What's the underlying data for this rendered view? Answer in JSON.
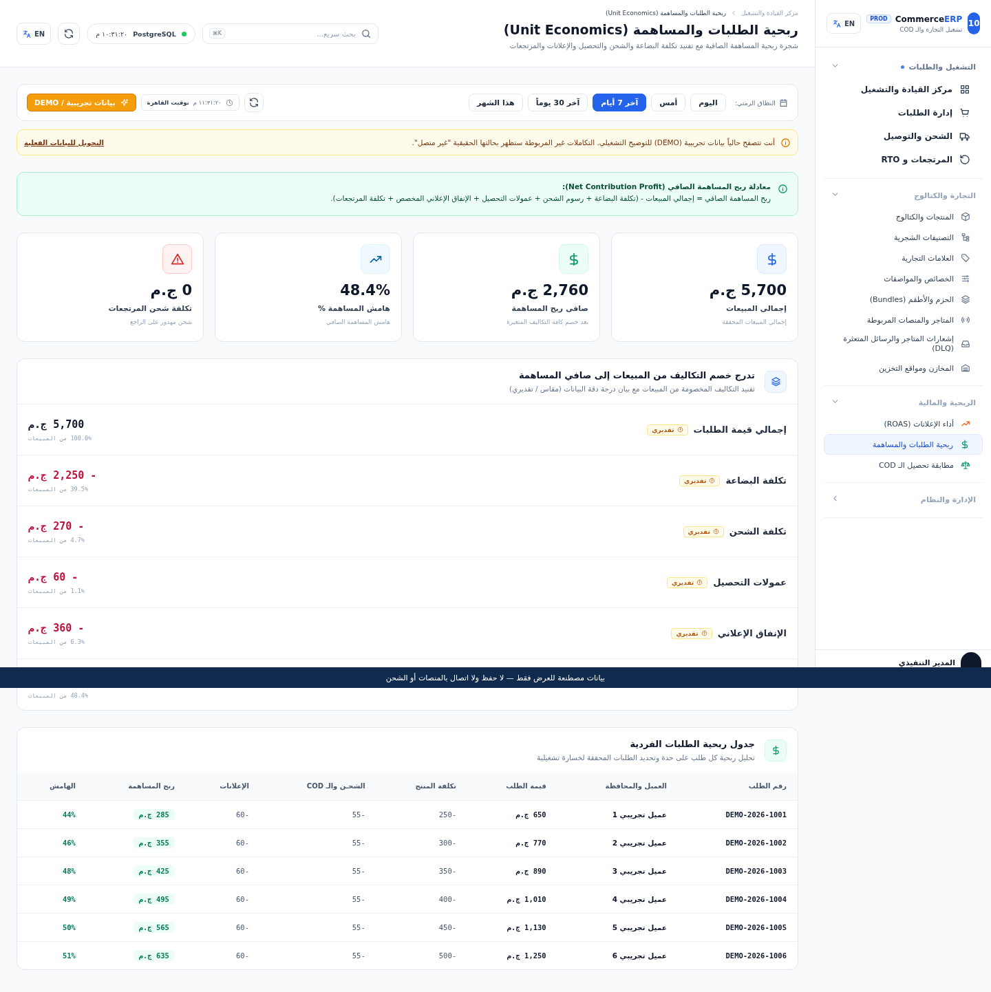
{
  "sidebar": {
    "brand": {
      "badge": "10",
      "name": "Commerce",
      "name_accent": "ERP",
      "env": "PROD",
      "subtitle": "تشغيل التجارة والـ COD"
    },
    "lang": "EN",
    "groups": [
      {
        "title": "التشغيل والطلبات",
        "kind": "main",
        "indicator": true,
        "expanded": true,
        "items": [
          {
            "label": "مركز القيادة والتشغيل",
            "selected": false
          },
          {
            "label": "إدارة الطلبات",
            "selected": false
          },
          {
            "label": "الشحن والتوصيل",
            "selected": false
          },
          {
            "label": "المرتجعات و RTO",
            "selected": false
          }
        ]
      },
      {
        "title": "التجارة والكتالوج",
        "kind": "sub",
        "indicator": false,
        "expanded": true,
        "items": [
          {
            "label": "المنتجات والكتالوج",
            "selected": false
          },
          {
            "label": "التصنيفات الشجرية",
            "selected": false
          },
          {
            "label": "العلامات التجارية",
            "selected": false
          },
          {
            "label": "الخصائص والمواصفات",
            "selected": false
          },
          {
            "label": "الحزم والأطقم (Bundles)",
            "selected": false
          },
          {
            "label": "المتاجر والمنصات المربوطة",
            "selected": false
          },
          {
            "label": "إشعارات المتاجر والرسائل المتعثرة (DLQ)",
            "selected": false
          },
          {
            "label": "المخازن ومواقع التخزين",
            "selected": false
          }
        ]
      },
      {
        "title": "الربحية والمالية",
        "kind": "sub",
        "indicator": false,
        "expanded": true,
        "items": [
          {
            "label": "أداء الإعلانات (ROAS)",
            "selected": false
          },
          {
            "label": "ربحية الطلبات والمساهمة",
            "selected": true
          },
          {
            "label": "مطابقة تحصيل الـ COD",
            "selected": false
          }
        ]
      },
      {
        "title": "الإدارة والنظام",
        "kind": "sub",
        "indicator": false,
        "expanded": false
      }
    ],
    "footer": {
      "user": "المدير التنفيذي"
    }
  },
  "header": {
    "breadcrumb": [
      "مركز القيادة والتشغيل",
      "ربحية الطلبات والمساهمة (Unit Economics)"
    ],
    "title": "ربحية الطلبات والمساهمة (Unit Economics)",
    "subtitle": "شجرة ربحية المساهمة الصافية مع تفنيد تكلفة البضاعة والشحن والتحصيل والإعلانات والمرتجعات",
    "search": {
      "placeholder": "بحث سريع...",
      "shortcut": "K⌘"
    },
    "status": {
      "db": "PostgreSQL",
      "time": "١٠:٣١:٢٠ م"
    },
    "lang": "EN"
  },
  "filters": {
    "label": "النطاق الزمني:",
    "ranges": [
      {
        "label": "اليوم",
        "selected": false
      },
      {
        "label": "أمس",
        "selected": false
      },
      {
        "label": "آخر 7 أيام",
        "selected": true
      },
      {
        "label": "آخر 30 يوماً",
        "selected": false
      },
      {
        "label": "هذا الشهر",
        "selected": false
      }
    ],
    "clock": {
      "time": "١١:٣١:٢٠ م",
      "zone": "توقيت القاهرة"
    },
    "demo_button": "بيانات تجريبية / DEMO"
  },
  "demo_alert": {
    "text": "أنت تتصفح حالياً بيانات تجريبية (DEMO) للتوضيح التشغيلي. التكاملات غير المربوطة ستظهر بحالتها الحقيقية \"غير متصل\".",
    "link": "التحويل للبيانات الفعلية"
  },
  "formula": {
    "title": "معادلة ربح المساهمة الصافي (Net Contribution Profit):",
    "body": "ربح المساهمة الصافي = إجمالي المبيعات - (تكلفة البضاعة + رسوم الشحن + عمولات التحصيل + الإنفاق الإعلاني المخصص + تكلفة المرتجعات)."
  },
  "kpis": [
    {
      "kind": "sales",
      "value": "5,700 ج.م",
      "label": "إجمالى المبيعات",
      "sub": "إجمالي المبيعات المحققة"
    },
    {
      "kind": "profit",
      "value": "2,760 ج.م",
      "label": "صافى ربح المساهمة",
      "sub": "بعد خصم كافة التكاليف المتغيرة"
    },
    {
      "kind": "margin",
      "value": "48.4%",
      "label": "هامش المساهمة %",
      "sub": "هامش المساهمة الصافي"
    },
    {
      "kind": "returns",
      "value": "0 ج.م",
      "label": "تكلفة شحن المرتجعات",
      "sub": "شحن مهدور على الراجع"
    }
  ],
  "waterfall": {
    "title": "تدرج خصم التكاليف من المبيعات إلى صافي المساهمة",
    "subtitle": "تفنيد التكاليف المخصومة من المبيعات مع بيان درجة دقة البيانات (مقاس / تقديري)",
    "rows": [
      {
        "label": "إجمالي قيمة الطلبات",
        "badge": "تقديري",
        "value": "5,700 ج.م",
        "negative": false,
        "share": "100.0% من المبيعات"
      },
      {
        "label": "تكلفة البضاعة",
        "badge": "تقديري",
        "value": "- 2,250 ج.م",
        "negative": true,
        "share": "39.5% من المبيعات"
      },
      {
        "label": "تكلفة الشحن",
        "badge": "تقديري",
        "value": "- 270 ج.م",
        "negative": true,
        "share": "4.7% من المبيعات"
      },
      {
        "label": "عمولات التحصيل",
        "badge": "تقديري",
        "value": "- 60 ج.م",
        "negative": true,
        "share": "1.1% من المبيعات"
      },
      {
        "label": "الإنفاق الإعلاني",
        "badge": "تقديري",
        "value": "- 360 ج.م",
        "negative": true,
        "share": "6.3% من المبيعات"
      },
      {
        "share": "48.4% من المبيعات"
      }
    ]
  },
  "orders_table": {
    "title": "جدول ربحية الطلبات الفردية",
    "subtitle": "تحليل ربحية كل طلب على حدة وتحديد الطلبات المحققة لخسارة تشغيلية",
    "columns": [
      "رقم الطلب",
      "العميل والمحافظة",
      "قيمة الطلب",
      "تكلفة المنتج",
      "الشحـن والـ COD",
      "الإعلانات",
      "ربح المساهمة",
      "الهامش"
    ],
    "rows": [
      [
        "DEMO-2026-1001",
        "عميل تجريبي 1",
        "650 ج.م",
        "-250",
        "-55",
        "-60",
        "285 ج.م",
        "44%"
      ],
      [
        "DEMO-2026-1002",
        "عميل تجريبي 2",
        "770 ج.م",
        "-300",
        "-55",
        "-60",
        "355 ج.م",
        "46%"
      ],
      [
        "DEMO-2026-1003",
        "عميل تجريبي 3",
        "890 ج.م",
        "-350",
        "-55",
        "-60",
        "425 ج.م",
        "48%"
      ],
      [
        "DEMO-2026-1004",
        "عميل تجريبي 4",
        "1,010 ج.م",
        "-400",
        "-55",
        "-60",
        "495 ج.م",
        "49%"
      ],
      [
        "DEMO-2026-1005",
        "عميل تجريبي 5",
        "1,130 ج.م",
        "-450",
        "-55",
        "-60",
        "565 ج.م",
        "50%"
      ],
      [
        "DEMO-2026-1006",
        "عميل تجريبي 6",
        "1,250 ج.م",
        "-500",
        "-55",
        "-60",
        "635 ج.م",
        "51%"
      ]
    ]
  },
  "banner": "بيانات مصطنعة للعرض فقط — لا حفظ ولا اتصال بالمنصات أو الشحن"
}
